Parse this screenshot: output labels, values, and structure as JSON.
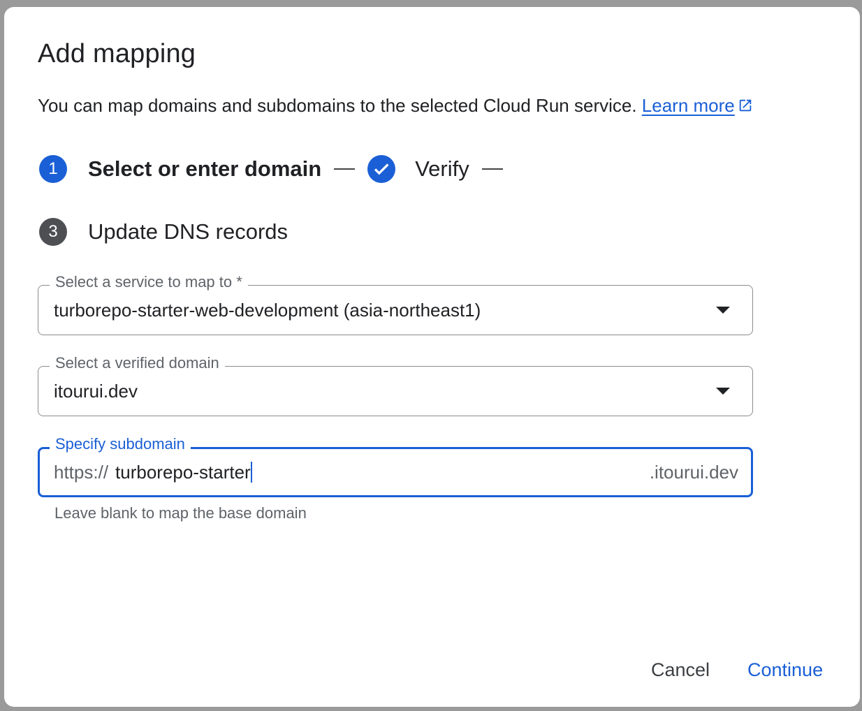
{
  "dialog": {
    "title": "Add mapping",
    "description": "You can map domains and subdomains to the selected Cloud Run service.",
    "learn_more": "Learn more"
  },
  "stepper": {
    "steps": [
      {
        "number": "1",
        "label": "Select or enter domain",
        "state": "active"
      },
      {
        "number": "2",
        "label": "Verify",
        "state": "done"
      },
      {
        "number": "3",
        "label": "Update DNS records",
        "state": "pending"
      }
    ]
  },
  "form": {
    "service": {
      "label": "Select a service to map to *",
      "value": "turborepo-starter-web-development (asia-northeast1)"
    },
    "domain": {
      "label": "Select a verified domain",
      "value": "itourui.dev"
    },
    "subdomain": {
      "label": "Specify subdomain",
      "prefix": "https://",
      "value": "turborepo-starter",
      "suffix": ".itourui.dev",
      "hint": "Leave blank to map the base domain"
    }
  },
  "actions": {
    "cancel": "Cancel",
    "continue": "Continue"
  },
  "colors": {
    "accent": "#1a5fd6",
    "pending_step": "#4d4f52",
    "text": "#202124",
    "muted": "#5f6368"
  }
}
